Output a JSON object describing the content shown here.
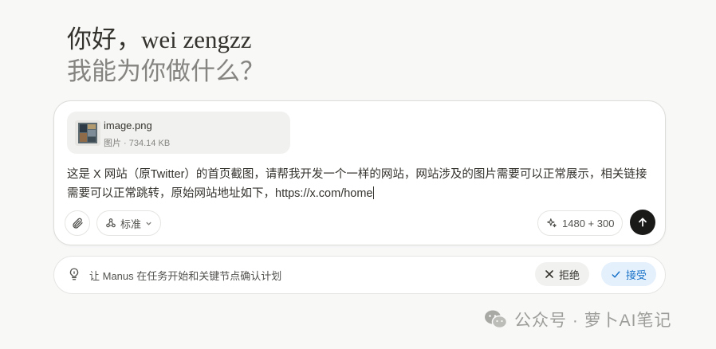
{
  "greeting": {
    "line1": "你好，wei zengzz",
    "line2": "我能为你做什么？"
  },
  "composer": {
    "attachment": {
      "name": "image.png",
      "meta": "图片 · 734.14 KB"
    },
    "prompt": "这是 X 网站（原Twitter）的首页截图，请帮我开发一个一样的网站，网站涉及的图片需要可以正常展示，相关链接需要可以正常跳转，原始网站地址如下，https://x.com/home",
    "toolbar": {
      "attach_icon": "paperclip-icon",
      "mode_icon": "cluster-icon",
      "mode_label": "标准",
      "credits_icon": "sparkle-icon",
      "credits": "1480 + 300",
      "send_icon": "arrow-up-icon"
    }
  },
  "plan_bar": {
    "icon": "lightbulb-icon",
    "text": "让 Manus 在任务开始和关键节点确认计划",
    "reject_label": "拒绝",
    "accept_label": "接受"
  },
  "watermark": {
    "text": "公众号 · 萝卜AI笔记"
  },
  "colors": {
    "background": "#f8f8f7",
    "accent": "#1a73c9",
    "send_button": "#1a1a19"
  }
}
